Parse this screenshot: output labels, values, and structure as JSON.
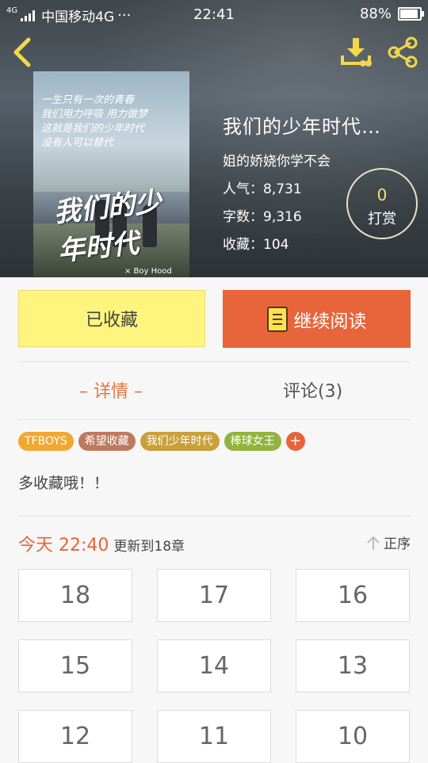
{
  "status_bar": {
    "network": "4G",
    "carrier": "中国移动4G",
    "dots": "···",
    "time": "22:41",
    "battery": "88%"
  },
  "book": {
    "title": "我们的少年时代…",
    "author": "姐的娇娆你学不会",
    "popularity": "人气：8,731",
    "word_count": "字数：9,316",
    "favorites": "收藏：104",
    "reward_count": "0",
    "reward_label": "打赏",
    "cover_handwriting": [
      "一生只有一次的青春",
      "我们用力呼吸 用力做梦",
      "这就是我们的少年时代",
      "没有人可以替代"
    ],
    "cover_title": "我们的少年时代",
    "cover_subtitle": "× Boy Hood"
  },
  "actions": {
    "favorited_label": "已收藏",
    "continue_label": "继续阅读"
  },
  "tabs": {
    "detail": "– 详情 –",
    "comments": "评论(3)"
  },
  "tags": [
    {
      "label": "TFBOYS",
      "color": "#f1a832"
    },
    {
      "label": "希望收藏",
      "color": "#bd7a5e"
    },
    {
      "label": "我们少年时代",
      "color": "#c9a03a"
    },
    {
      "label": "棒球女王",
      "color": "#93b33f"
    }
  ],
  "tag_add": "+",
  "description": "多收藏哦！！",
  "update": {
    "time": "今天 22:40",
    "text": "更新到18章",
    "order_label": "正序"
  },
  "chapters": [
    "18",
    "17",
    "16",
    "15",
    "14",
    "13",
    "12",
    "11",
    "10"
  ],
  "colors": {
    "accent": "#e8643a",
    "favorite_bg": "#fff57e",
    "icon_yellow": "#f2d84a"
  }
}
